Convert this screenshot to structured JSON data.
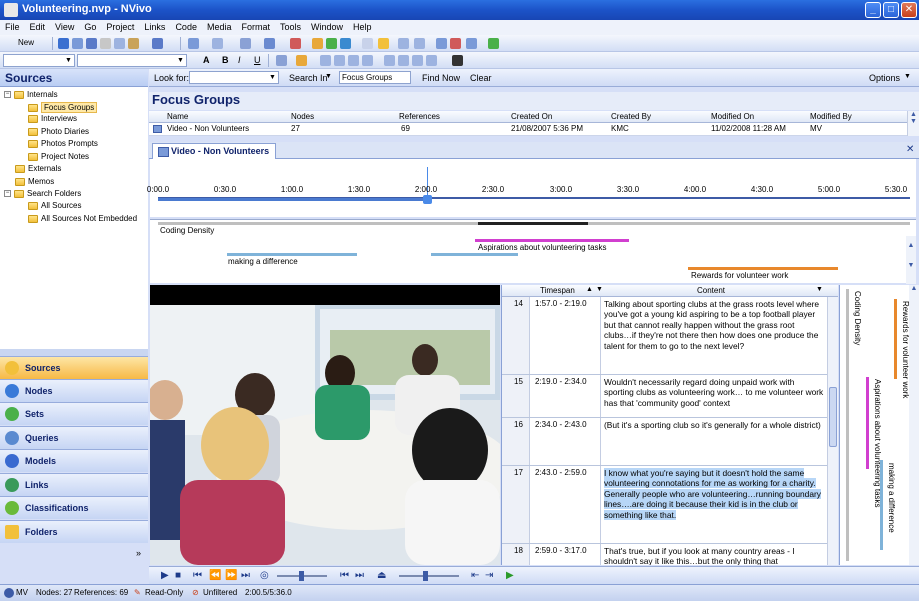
{
  "window": {
    "title": "Volunteering.nvp - NVivo"
  },
  "menu": [
    "File",
    "Edit",
    "View",
    "Go",
    "Project",
    "Links",
    "Code",
    "Media",
    "Format",
    "Tools",
    "Window",
    "Help"
  ],
  "toolbar": {
    "new_label": "New"
  },
  "nav": {
    "header": "Sources",
    "tree": [
      {
        "label": "Internals",
        "level": 0,
        "expanded": true
      },
      {
        "label": "Focus Groups",
        "level": 1,
        "selected": true
      },
      {
        "label": "Interviews",
        "level": 1
      },
      {
        "label": "Photo Diaries",
        "level": 1
      },
      {
        "label": "Photos Prompts",
        "level": 1
      },
      {
        "label": "Project Notes",
        "level": 1
      },
      {
        "label": "Externals",
        "level": 0
      },
      {
        "label": "Memos",
        "level": 0
      },
      {
        "label": "Search Folders",
        "level": 0,
        "expanded": true
      },
      {
        "label": "All Sources",
        "level": 1
      },
      {
        "label": "All Sources Not Embedded",
        "level": 1
      }
    ],
    "buttons": [
      "Sources",
      "Nodes",
      "Sets",
      "Queries",
      "Models",
      "Links",
      "Classifications",
      "Folders"
    ]
  },
  "find": {
    "look_for_label": "Look for:",
    "search_in_label": "Search In",
    "search_in_value": "Focus Groups",
    "find_now": "Find Now",
    "clear": "Clear",
    "options": "Options"
  },
  "list": {
    "title": "Focus Groups",
    "columns": [
      "Name",
      "Nodes",
      "References",
      "Created On",
      "Created By",
      "Modified On",
      "Modified By"
    ],
    "row": {
      "name": "Video - Non Volunteers",
      "nodes": "27",
      "references": "69",
      "created_on": "21/08/2007 5:36 PM",
      "created_by": "KMC",
      "modified_on": "11/02/2008 11:28 AM",
      "modified_by": "MV"
    }
  },
  "detail": {
    "tab": "Video - Non Volunteers",
    "timeline_ticks": [
      "0:00.0",
      "0:30.0",
      "1:00.0",
      "1:30.0",
      "2:00.0",
      "2:30.0",
      "3:00.0",
      "3:30.0",
      "4:00.0",
      "4:30.0",
      "5:00.0",
      "5:30.0"
    ],
    "coding_density": "Coding Density",
    "stripes": [
      "making a difference",
      "Aspirations about volunteering tasks",
      "Rewards for volunteer work"
    ]
  },
  "transcript": {
    "columns": [
      "Timespan",
      "Content"
    ],
    "rows": [
      {
        "num": "14",
        "span": "1:57.0 - 2:19.0",
        "text": "Talking about sporting clubs at the grass roots level where you've got a young kid aspiring to be a top football player but that cannot really happen without the grass root clubs…if they're not there then how does one produce the talent for them to go to the next level?"
      },
      {
        "num": "15",
        "span": "2:19.0 - 2:34.0",
        "text": " Wouldn't necessarily regard doing unpaid work with sporting clubs as volunteering work… to me volunteer work has that 'community good' context"
      },
      {
        "num": "16",
        "span": "2:34.0 - 2:43.0",
        "text": "(But it's a sporting club so it's generally for a whole district)"
      },
      {
        "num": "17",
        "span": "2:43.0 - 2:59.0",
        "text": "I know what you're saying but it doesn't hold the same volunteering connotations for me as working for a charity. Generally people who are volunteering…running boundary lines….are doing it because their kid is in the club or something like that.",
        "highlight": true
      },
      {
        "num": "18",
        "span": "2:59.0 - 3:17.0",
        "text": "That's true, but if you look at many country areas - I shouldn't say it like this…but the only thing that"
      }
    ]
  },
  "status": {
    "user": "MV",
    "nodes": "Nodes: 27",
    "references": "References: 69",
    "read_only": "Read-Only",
    "unfiltered": "Unfiltered",
    "position": "2:00.5/5:36.0"
  },
  "colors": {
    "stripe_blue": "#7fb3d9",
    "stripe_magenta": "#d13fcf",
    "stripe_orange": "#e8882c",
    "accent": "#1c53c8"
  }
}
